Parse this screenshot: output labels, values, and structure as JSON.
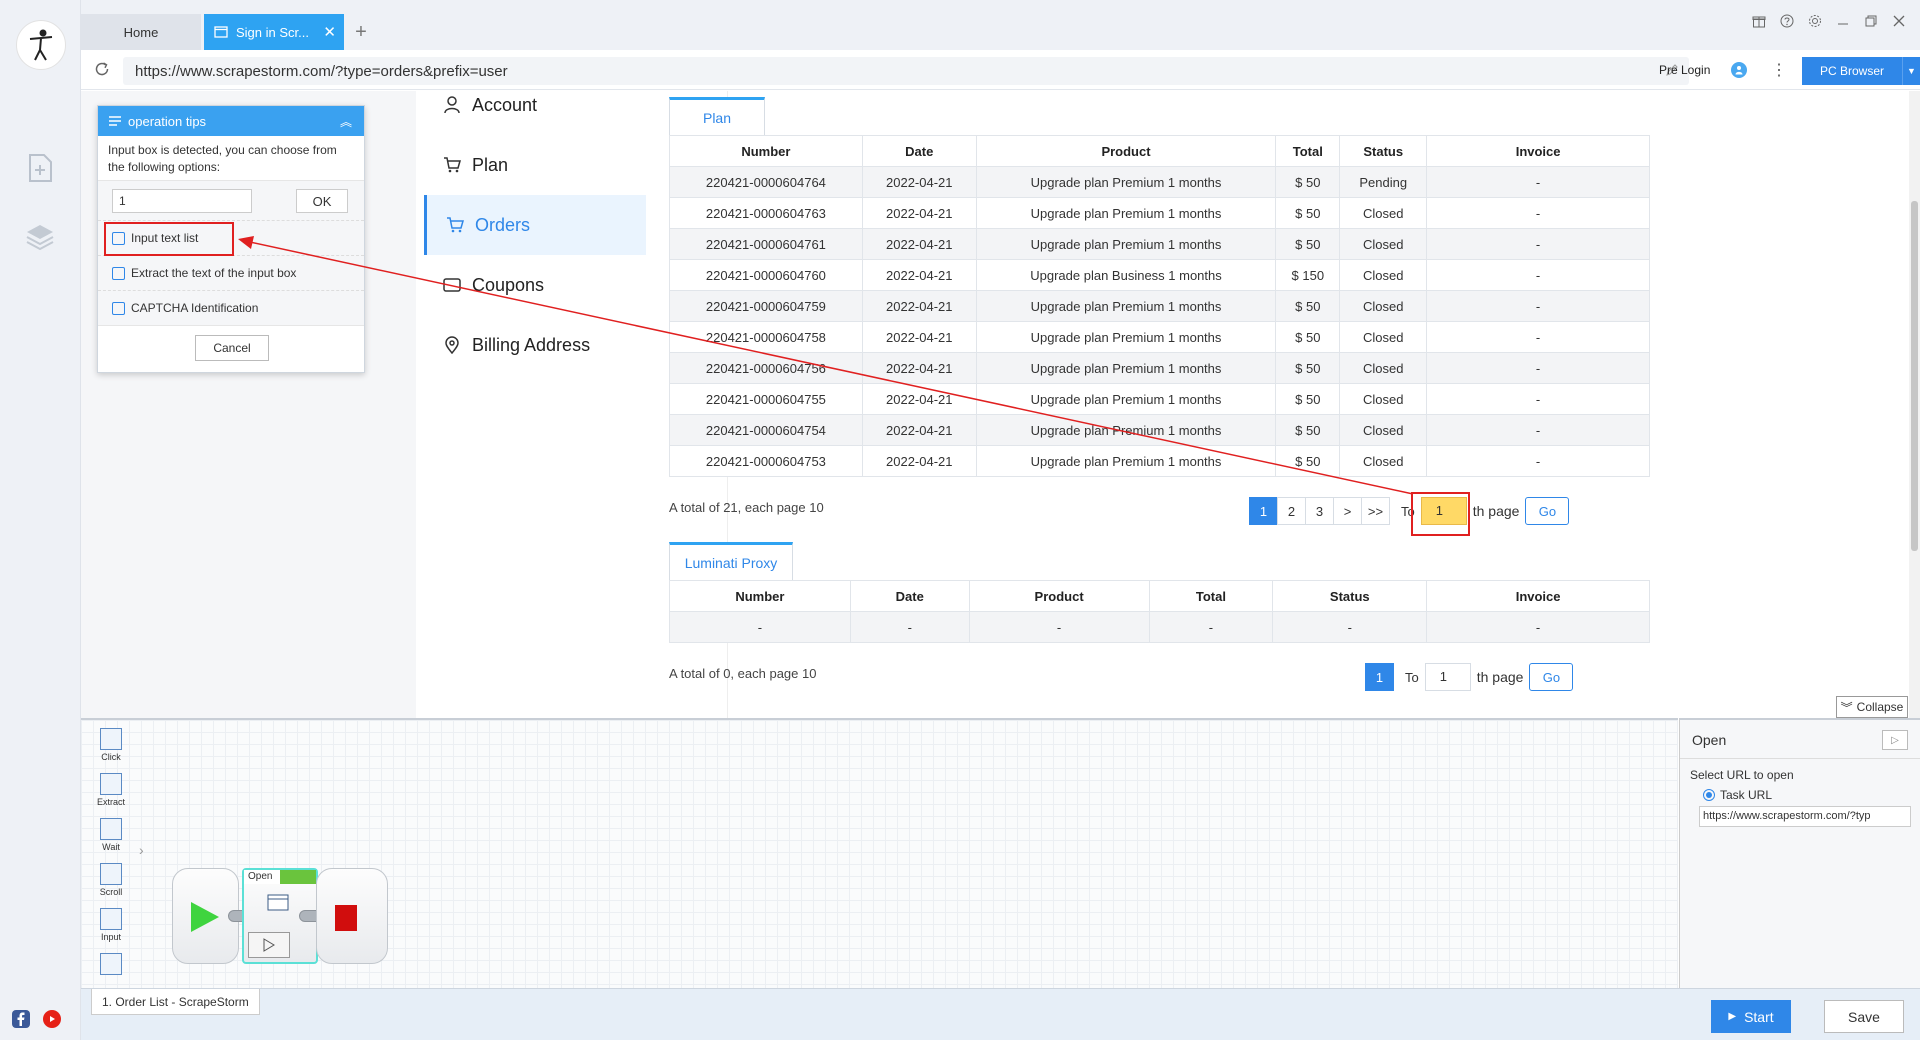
{
  "tabs": {
    "home": "Home",
    "active": "Sign in Scr...",
    "close": "✕",
    "plus": "+"
  },
  "urlbar": {
    "url": "https://www.scrapestorm.com/?type=orders&prefix=user",
    "pre_login": "Pre Login",
    "pc_browser": "PC Browser"
  },
  "nav": {
    "items": [
      {
        "label": "Account",
        "icon": "user-icon"
      },
      {
        "label": "Plan",
        "icon": "cart-icon"
      },
      {
        "label": "Orders",
        "icon": "cart-icon"
      },
      {
        "label": "Coupons",
        "icon": "tag-icon"
      },
      {
        "label": "Billing Address",
        "icon": "location-icon"
      }
    ],
    "active": "Orders"
  },
  "plan_section": {
    "tab": "Plan",
    "headers": [
      "Number",
      "Date",
      "Product",
      "Total",
      "Status",
      "Invoice"
    ],
    "rows": [
      [
        "220421-0000604764",
        "2022-04-21",
        "Upgrade plan Premium 1 months",
        "$ 50",
        "Pending",
        "-"
      ],
      [
        "220421-0000604763",
        "2022-04-21",
        "Upgrade plan Premium 1 months",
        "$ 50",
        "Closed",
        "-"
      ],
      [
        "220421-0000604761",
        "2022-04-21",
        "Upgrade plan Premium 1 months",
        "$ 50",
        "Closed",
        "-"
      ],
      [
        "220421-0000604760",
        "2022-04-21",
        "Upgrade plan Business 1 months",
        "$ 150",
        "Closed",
        "-"
      ],
      [
        "220421-0000604759",
        "2022-04-21",
        "Upgrade plan Premium 1 months",
        "$ 50",
        "Closed",
        "-"
      ],
      [
        "220421-0000604758",
        "2022-04-21",
        "Upgrade plan Premium 1 months",
        "$ 50",
        "Closed",
        "-"
      ],
      [
        "220421-0000604756",
        "2022-04-21",
        "Upgrade plan Premium 1 months",
        "$ 50",
        "Closed",
        "-"
      ],
      [
        "220421-0000604755",
        "2022-04-21",
        "Upgrade plan Premium 1 months",
        "$ 50",
        "Closed",
        "-"
      ],
      [
        "220421-0000604754",
        "2022-04-21",
        "Upgrade plan Premium 1 months",
        "$ 50",
        "Closed",
        "-"
      ],
      [
        "220421-0000604753",
        "2022-04-21",
        "Upgrade plan Premium 1 months",
        "$ 50",
        "Closed",
        "-"
      ]
    ],
    "total_text": "A total of 21, each page 10",
    "pages": [
      "1",
      "2",
      "3",
      ">",
      ">>"
    ],
    "to_label": "To",
    "page_value": "1",
    "th_page": "th page",
    "go": "Go"
  },
  "proxy_section": {
    "tab": "Luminati Proxy",
    "headers": [
      "Number",
      "Date",
      "Product",
      "Total",
      "Status",
      "Invoice"
    ],
    "rows": [
      [
        "-",
        "-",
        "-",
        "-",
        "-",
        "-"
      ]
    ],
    "total_text": "A total of 0, each page 10",
    "pages": [
      "1"
    ],
    "to_label": "To",
    "page_value": "1",
    "th_page": "th page",
    "go": "Go"
  },
  "tips": {
    "title": "operation tips",
    "description": "Input box is detected, you can choose from the following options:",
    "input_value": "1",
    "ok": "OK",
    "options": [
      "Input text list",
      "Extract the text of the input box",
      "CAPTCHA Identification"
    ],
    "cancel": "Cancel"
  },
  "collapse": "Collapse",
  "toolbox": [
    "Click",
    "Extract",
    "Wait",
    "Scroll",
    "Input"
  ],
  "workflow": {
    "node_label": "Open"
  },
  "props": {
    "title": "Open",
    "select_label": "Select URL to open",
    "radio_label": "Task URL",
    "url_value": "https://www.scrapestorm.com/?typ"
  },
  "bottom": {
    "task_tab": "1. Order List - ScrapeStorm",
    "start": "Start",
    "save": "Save"
  },
  "colors": {
    "accent": "#2f87e8",
    "tab_active": "#2ea3f2",
    "highlight_red": "#e02020",
    "page_input_highlight": "#ffd966"
  }
}
